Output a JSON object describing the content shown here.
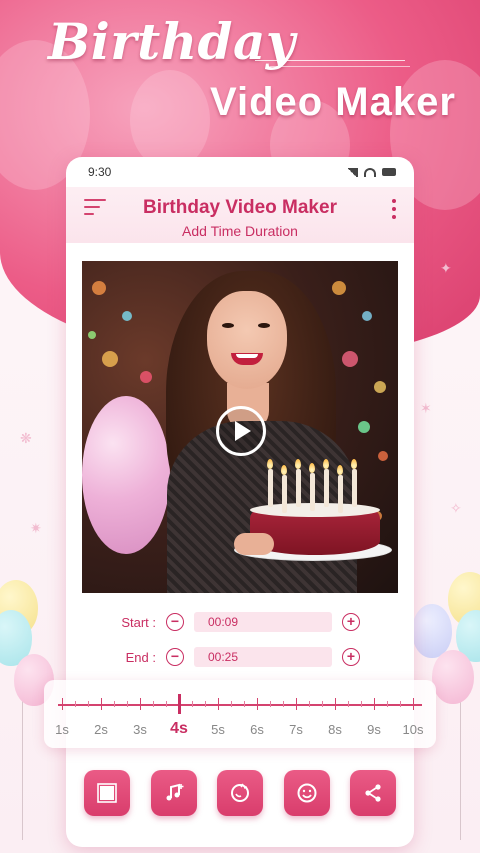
{
  "hero": {
    "title": "Birthday",
    "subtitle": "Video Maker"
  },
  "status_bar": {
    "time": "9:30"
  },
  "app_bar": {
    "title": "Birthday Video Maker",
    "subtitle": "Add Time Duration"
  },
  "trim": {
    "start_label": "Start :",
    "start_value": "00:09",
    "end_label": "End :",
    "end_value": "00:25",
    "minus": "−",
    "plus": "+"
  },
  "timeline": {
    "labels": [
      "1s",
      "2s",
      "3s",
      "4s",
      "5s",
      "6s",
      "7s",
      "8s",
      "9s",
      "10s"
    ],
    "active_index": 3
  },
  "actions": [
    "crop-icon",
    "music-icon",
    "sticker-icon",
    "emoji-icon",
    "share-icon"
  ],
  "colors": {
    "accent": "#c92e62",
    "button": "#e04a78",
    "soft": "#fbe4ec"
  }
}
